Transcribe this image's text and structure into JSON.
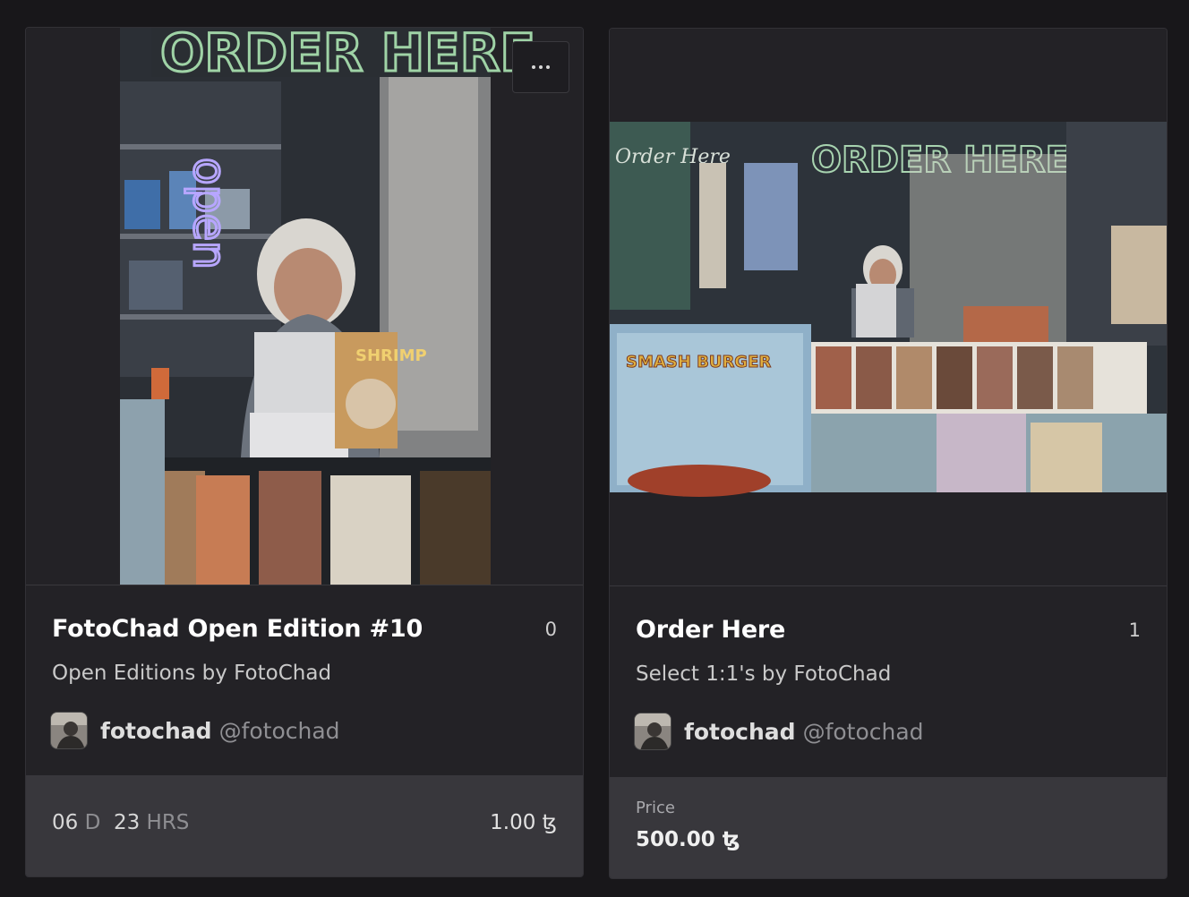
{
  "cards": [
    {
      "title": "FotoChad Open Edition #10",
      "count": "0",
      "collection": "Open Editions by FotoChad",
      "creator": {
        "name": "fotochad",
        "handle": "@fotochad"
      },
      "timer": {
        "days": "06",
        "days_unit": "D",
        "hours": "23",
        "hours_unit": "HRS"
      },
      "price": "1.00 ꜩ",
      "menu_icon": "more-horizontal-icon"
    },
    {
      "title": "Order Here",
      "count": "1",
      "collection": "Select 1:1's by FotoChad",
      "creator": {
        "name": "fotochad",
        "handle": "@fotochad"
      },
      "price_label": "Price",
      "price": "500.00 ꜩ"
    }
  ],
  "artwork_text": {
    "sign": "ORDER HERE",
    "neon": "open",
    "shrimp": "SHRIMP",
    "smash": "SMASH BURGER",
    "script": "Order Here"
  }
}
